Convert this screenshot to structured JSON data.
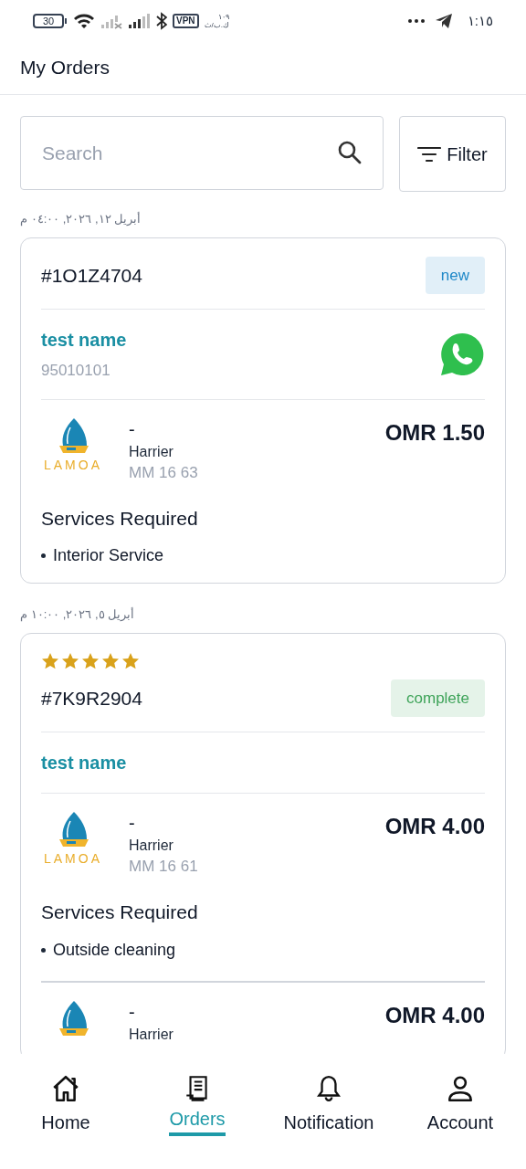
{
  "status_bar": {
    "battery": "30",
    "vpn": "VPN",
    "speed": "١٠٩\nك.ب/ث",
    "time": "١:١٥"
  },
  "header": {
    "title": "My Orders"
  },
  "search": {
    "placeholder": "Search"
  },
  "filter_button": {
    "label": "Filter"
  },
  "orders": [
    {
      "date": "أبريل ١٢, ٢٠٢٦, ٠٤:٠٠ م",
      "id": "#1O1Z4704",
      "status": {
        "label": "new",
        "color": "#1e88c8"
      },
      "customer": {
        "name": "test name",
        "phone": "95010101",
        "whatsapp": true
      },
      "items": [
        {
          "logo_text": "LAMOA",
          "title": "-",
          "car": "Harrier",
          "plate": "MM 16 63",
          "price": "OMR 1.50",
          "services_heading": "Services Required",
          "services": [
            "Interior Service"
          ]
        }
      ]
    },
    {
      "date": "أبريل ٥, ٢٠٢٦, ١٠:٠٠ م",
      "stars": 5,
      "id": "#7K9R2904",
      "status": {
        "label": "complete",
        "color": "#3fa45a"
      },
      "customer": {
        "name": "test name",
        "whatsapp": false
      },
      "items": [
        {
          "logo_text": "LAMOA",
          "title": "-",
          "car": "Harrier",
          "plate": "MM 16 61",
          "price": "OMR 4.00",
          "services_heading": "Services Required",
          "services": [
            "Outside cleaning"
          ]
        },
        {
          "title": "-",
          "car": "Harrier",
          "price": "OMR 4.00"
        }
      ]
    }
  ],
  "nav": [
    {
      "label": "Home",
      "kind": "home",
      "selected": false
    },
    {
      "label": "Orders",
      "kind": "orders",
      "selected": true
    },
    {
      "label": "Notification",
      "kind": "bell",
      "selected": false
    },
    {
      "label": "Account",
      "kind": "user",
      "selected": false
    }
  ]
}
